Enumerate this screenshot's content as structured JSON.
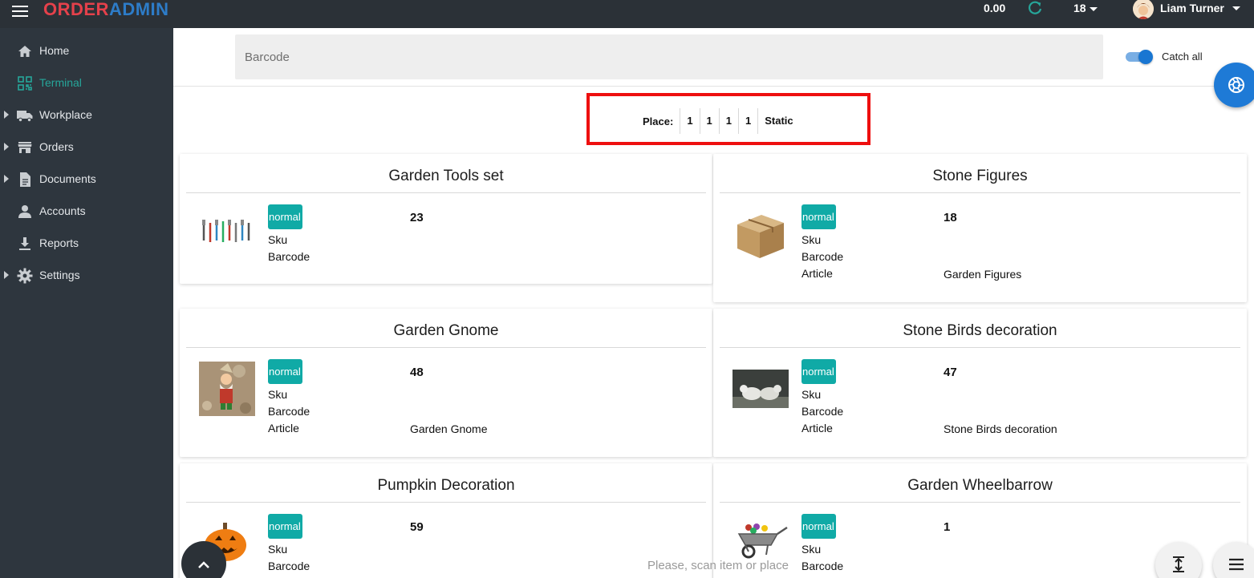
{
  "header": {
    "logo_part1": "ORDER",
    "logo_part2": "ADMIN",
    "balance": "0.00",
    "counter": "18",
    "username": "Liam Turner",
    "icons": [
      "menu-icon",
      "refresh-icon",
      "avatar",
      "chevron-down-icon"
    ]
  },
  "sidebar": {
    "items": [
      {
        "label": "Home",
        "icon": "home-icon",
        "expandable": false,
        "active": false
      },
      {
        "label": "Terminal",
        "icon": "qr-code-icon",
        "expandable": false,
        "active": true
      },
      {
        "label": "Workplace",
        "icon": "truck-icon",
        "expandable": true,
        "active": false
      },
      {
        "label": "Orders",
        "icon": "store-icon",
        "expandable": true,
        "active": false
      },
      {
        "label": "Documents",
        "icon": "document-icon",
        "expandable": true,
        "active": false
      },
      {
        "label": "Accounts",
        "icon": "person-icon",
        "expandable": false,
        "active": false
      },
      {
        "label": "Reports",
        "icon": "download-icon",
        "expandable": false,
        "active": false
      },
      {
        "label": "Settings",
        "icon": "gear-icon",
        "expandable": true,
        "active": false
      }
    ]
  },
  "search": {
    "placeholder": "Barcode",
    "value": "",
    "toggle_label": "Catch all",
    "toggle_on": true
  },
  "place": {
    "label": "Place:",
    "segments": [
      "1",
      "1",
      "1",
      "1",
      "Static"
    ]
  },
  "products": [
    {
      "title": "Garden Tools set",
      "status": "normal",
      "quantity": "23",
      "rows": [
        {
          "label": "Sku",
          "value": ""
        },
        {
          "label": "Barcode",
          "value": ""
        }
      ]
    },
    {
      "title": "Stone Figures",
      "status": "normal",
      "quantity": "18",
      "rows": [
        {
          "label": "Sku",
          "value": ""
        },
        {
          "label": "Barcode",
          "value": ""
        },
        {
          "label": "Article",
          "value": "Garden Figures"
        }
      ]
    },
    {
      "title": "Garden Gnome",
      "status": "normal",
      "quantity": "48",
      "rows": [
        {
          "label": "Sku",
          "value": ""
        },
        {
          "label": "Barcode",
          "value": ""
        },
        {
          "label": "Article",
          "value": "Garden Gnome"
        }
      ]
    },
    {
      "title": "Stone Birds decoration",
      "status": "normal",
      "quantity": "47",
      "rows": [
        {
          "label": "Sku",
          "value": ""
        },
        {
          "label": "Barcode",
          "value": ""
        },
        {
          "label": "Article",
          "value": "Stone Birds decoration"
        }
      ]
    },
    {
      "title": "Pumpkin Decoration",
      "status": "normal",
      "quantity": "59",
      "rows": [
        {
          "label": "Sku",
          "value": ""
        },
        {
          "label": "Barcode",
          "value": ""
        }
      ]
    },
    {
      "title": "Garden Wheelbarrow",
      "status": "normal",
      "quantity": "1",
      "rows": [
        {
          "label": "Sku",
          "value": ""
        },
        {
          "label": "Barcode",
          "value": ""
        }
      ]
    }
  ],
  "footer": {
    "hint": "Please, scan item or place",
    "icons": [
      "chevron-up-icon",
      "vertical-align-icon",
      "menu-lines-icon",
      "camera-icon"
    ]
  },
  "colors": {
    "topbar": "#2b3137",
    "sidebar": "#2e363e",
    "accent_teal": "#10aaa6",
    "accent_blue": "#1e7ad6",
    "highlight_red": "#ee0f0f",
    "logo_red": "#e5414b",
    "logo_blue": "#2d7cc8"
  }
}
